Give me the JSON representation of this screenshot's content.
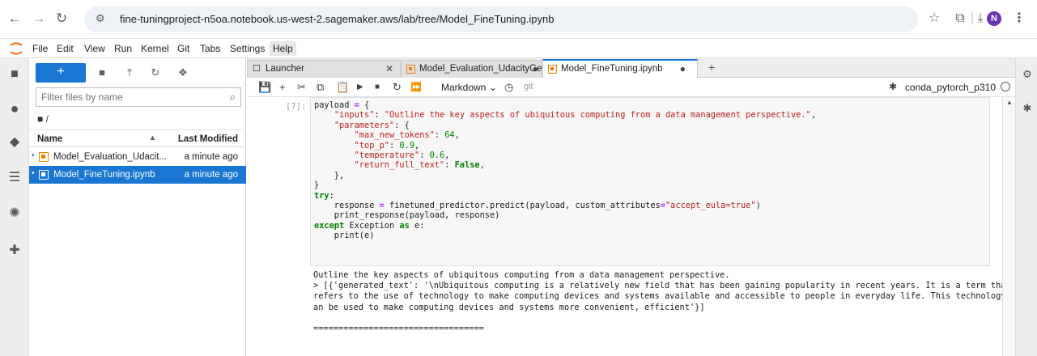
{
  "browser": {
    "url": "fine-tuningproject-n5oa.notebook.us-west-2.sagemaker.aws/lab/tree/Model_FineTuning.ipynb",
    "avatar_letter": "N"
  },
  "menubar": {
    "items": [
      "File",
      "Edit",
      "View",
      "Run",
      "Kernel",
      "Git",
      "Tabs",
      "Settings",
      "Help"
    ]
  },
  "filebrowser": {
    "new_label": "+",
    "filter_placeholder": "Filter files by name",
    "breadcrumb": "/",
    "col_name": "Name",
    "col_modified": "Last Modified",
    "files": [
      {
        "name": "Model_Evaluation_Udacit...",
        "modified": "a minute ago"
      },
      {
        "name": "Model_FineTuning.ipynb",
        "modified": "a minute ago"
      }
    ]
  },
  "tabs": [
    {
      "label": "Launcher"
    },
    {
      "label": "Model_Evaluation_UdacityGe"
    },
    {
      "label": "Model_FineTuning.ipynb"
    }
  ],
  "toolbar": {
    "cell_type": "Markdown",
    "git_label": "git",
    "kernel": "conda_pytorch_p310"
  },
  "cell": {
    "prompt": "[7]:",
    "code_lines": [
      "payload = {",
      "    \"inputs\": \"Outline the key aspects of ubiquitous computing from a data management perspective.\",",
      "    \"parameters\": {",
      "        \"max_new_tokens\": 64,",
      "        \"top_p\": 0.9,",
      "        \"temperature\": 0.6,",
      "        \"return_full_text\": False,",
      "    },",
      "}",
      "try:",
      "    response = finetuned_predictor.predict(payload, custom_attributes=\"accept_eula=true\")",
      "    print_response(payload, response)",
      "except Exception as e:",
      "    print(e)"
    ],
    "output_lines": [
      "Outline the key aspects of ubiquitous computing from a data management perspective.",
      "> [{'generated_text': '\\nUbiquitous computing is a relatively new field that has been gaining popularity in recent years. It is a term that",
      "refers to the use of technology to make computing devices and systems available and accessible to people in everyday life. This technology c",
      "an be used to make computing devices and systems more convenient, efficient'}]",
      "",
      "=================================="
    ]
  },
  "colors": {
    "accent": "#1976d2",
    "notebook_icon": "#f57c00",
    "avatar": "#6833b5"
  }
}
